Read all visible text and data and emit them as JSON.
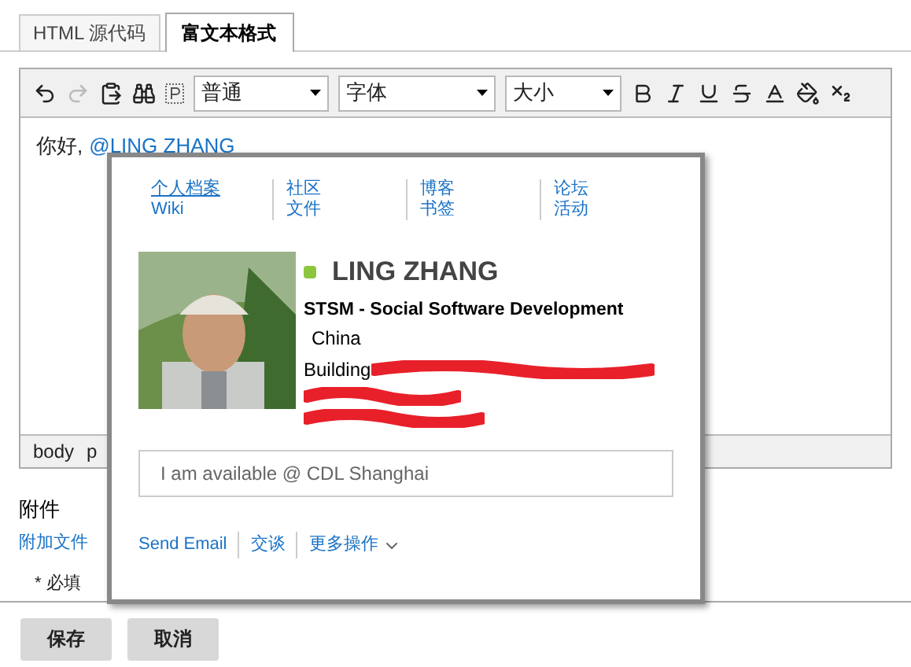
{
  "tabs": [
    {
      "label": "HTML 源代码",
      "selected": false
    },
    {
      "label": "富文本格式",
      "selected": true
    }
  ],
  "toolbar": {
    "selects": [
      {
        "value": "普通"
      },
      {
        "value": "字体"
      },
      {
        "value": "大小"
      }
    ]
  },
  "editor": {
    "greeting": "你好,",
    "mention": "@LING ZHANG"
  },
  "element_path": [
    "body",
    "p"
  ],
  "business_card": {
    "links": [
      {
        "items": [
          "个人档案",
          "Wiki"
        ]
      },
      {
        "items": [
          "社区",
          "文件"
        ]
      },
      {
        "items": [
          "博客",
          "书签"
        ]
      },
      {
        "items": [
          "论坛",
          "活动"
        ]
      }
    ],
    "photo": {
      "kind": "picture"
    },
    "status_indicator": {
      "color": "#8cc63f"
    },
    "name": "LING ZHANG",
    "title": "STSM - Social Software Development",
    "country": "China",
    "address": "Building",
    "status_message": "I am available @ CDL Shanghai",
    "actions": [
      "Send Email",
      "交谈",
      "更多操作"
    ]
  },
  "attachments": {
    "heading": "附件",
    "link": "附加文件"
  },
  "required_note": "* 必填",
  "buttons": [
    "保存",
    "取消"
  ]
}
